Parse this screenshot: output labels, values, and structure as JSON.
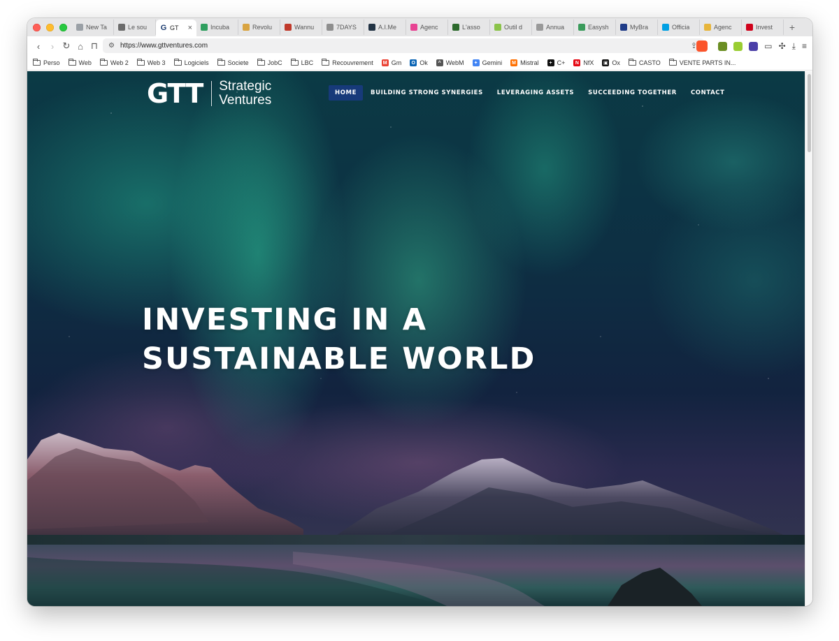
{
  "browser": {
    "tabs": [
      {
        "label": "New Ta",
        "color": "#9aa0a6"
      },
      {
        "label": "Le sou",
        "color": "#6b6b6b"
      },
      {
        "label": "GT",
        "color": "#ffffff",
        "active": true
      },
      {
        "label": "Incuba",
        "color": "#2e9e5e"
      },
      {
        "label": "Revolu",
        "color": "#d9a441"
      },
      {
        "label": "Wannu",
        "color": "#c0392b"
      },
      {
        "label": "7DAYS",
        "color": "#8e8e8e"
      },
      {
        "label": "A.I.Me",
        "color": "#223344"
      },
      {
        "label": "Agenc",
        "color": "#e84393"
      },
      {
        "label": "L'asso",
        "color": "#2d6a2d"
      },
      {
        "label": "Outil d",
        "color": "#8bc34a"
      },
      {
        "label": "Annua",
        "color": "#999999"
      },
      {
        "label": "Easysh",
        "color": "#3a9b5b"
      },
      {
        "label": "MyBra",
        "color": "#1f3c88"
      },
      {
        "label": "Officia",
        "color": "#00a0e3"
      },
      {
        "label": "Agenc",
        "color": "#e7b53b"
      },
      {
        "label": "Invest",
        "color": "#d0021b"
      }
    ],
    "active_tab_close": "×",
    "new_tab": "+",
    "url": "https://www.gttventures.com",
    "bookmarks": [
      {
        "label": "Perso",
        "type": "folder"
      },
      {
        "label": "Web",
        "type": "folder"
      },
      {
        "label": "Web 2",
        "type": "folder"
      },
      {
        "label": "Web 3",
        "type": "folder"
      },
      {
        "label": "Logiciels",
        "type": "folder"
      },
      {
        "label": "Societe",
        "type": "folder"
      },
      {
        "label": "JobC",
        "type": "folder"
      },
      {
        "label": "LBC",
        "type": "folder"
      },
      {
        "label": "Recouvrement",
        "type": "folder"
      },
      {
        "label": "Gm",
        "type": "site",
        "icon": "M",
        "color": "#ea4335"
      },
      {
        "label": "Ok",
        "type": "site",
        "icon": "O",
        "color": "#0a64b4"
      },
      {
        "label": "WebM",
        "type": "site",
        "icon": "^",
        "color": "#555555"
      },
      {
        "label": "Gemini",
        "type": "site",
        "icon": "✦",
        "color": "#4285f4"
      },
      {
        "label": "Mistral",
        "type": "site",
        "icon": "M",
        "color": "#ff7000"
      },
      {
        "label": "C+",
        "type": "site",
        "icon": "+",
        "color": "#111111"
      },
      {
        "label": "NfX",
        "type": "site",
        "icon": "N",
        "color": "#e50914"
      },
      {
        "label": "Ox",
        "type": "site",
        "icon": "▣",
        "color": "#111111"
      },
      {
        "label": "CASTO",
        "type": "folder"
      },
      {
        "label": "VENTE PARTS IN...",
        "type": "folder"
      }
    ]
  },
  "site": {
    "logo_mark": "GTT",
    "logo_line1": "Strategic",
    "logo_line2": "Ventures",
    "nav": [
      {
        "label": "HOME",
        "active": true
      },
      {
        "label": "BUILDING STRONG SYNERGIES"
      },
      {
        "label": "LEVERAGING ASSETS"
      },
      {
        "label": "SUCCEEDING TOGETHER"
      },
      {
        "label": "CONTACT"
      }
    ],
    "hero_line1": "INVESTING IN A",
    "hero_line2": "SUSTAINABLE WORLD"
  },
  "colors": {
    "nav_active_bg": "#173a7a",
    "hero_text": "#ffffff"
  }
}
